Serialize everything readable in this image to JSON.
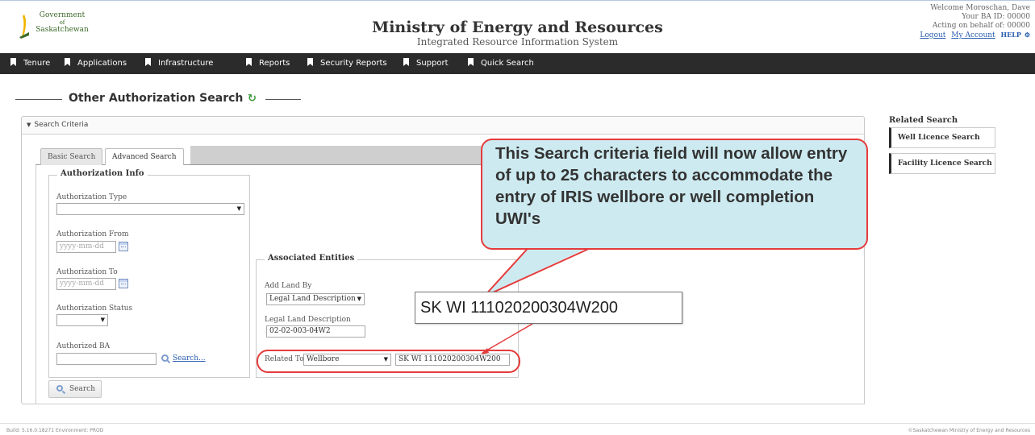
{
  "header": {
    "logo_line1": "Government",
    "logo_line2": "of",
    "logo_line3": "Saskatchewan",
    "ministry": "Ministry of Energy and Resources",
    "system": "Integrated Resource Information System",
    "welcome": "Welcome Moroschan, Dave",
    "ba_id": "Your BA ID: 00000",
    "acting": "Acting on behalf of: 00000",
    "logout": "Logout",
    "my_account": "My Account",
    "help": "HELP"
  },
  "nav": {
    "items": [
      "Tenure",
      "Applications",
      "Infrastructure",
      "Reports",
      "Security Reports",
      "Support",
      "Quick Search"
    ]
  },
  "page": {
    "title": "Other Authorization Search",
    "refresh_icon": "refresh-icon"
  },
  "panel": {
    "header": "Search Criteria",
    "tabs": [
      "Basic Search",
      "Advanced Search"
    ],
    "authorization_info": {
      "legend": "Authorization Info",
      "type_label": "Authorization Type",
      "type_value": "",
      "from_label": "Authorization From",
      "from_placeholder": "yyyy-mm-dd",
      "to_label": "Authorization To",
      "to_placeholder": "yyyy-mm-dd",
      "status_label": "Authorization Status",
      "status_value": "",
      "ba_label": "Authorized BA",
      "ba_value": "",
      "ba_search": "Search..."
    },
    "associated_entities": {
      "legend": "Associated Entities",
      "add_land_by_label": "Add Land By",
      "add_land_by_value": "Legal Land Description",
      "legal_land_label": "Legal Land Description",
      "legal_land_value": "02-02-003-04W2",
      "related_to_label": "Related To",
      "related_to_value": "Wellbore",
      "related_value": "SK WI 111020200304W200"
    },
    "search_button": "Search"
  },
  "callout": {
    "text": "This Search criteria field will now allow entry of up to 25 characters to accommodate the entry of IRIS wellbore or well completion UWI's",
    "zoom_value": "SK WI 111020200304W200"
  },
  "related": {
    "title": "Related Search",
    "items": [
      "Well Licence Search",
      "Facility Licence Search"
    ]
  },
  "footer": {
    "build": "Build: 5.16.0.18271 Environment: PROD",
    "copyright": "©Saskatchewan Ministry of Energy and Resources"
  },
  "colors": {
    "nav_bg": "#2b2b2b",
    "callout_bg": "#cdeaf0",
    "highlight_red": "#e53b3b",
    "link_blue": "#2a5db0"
  }
}
